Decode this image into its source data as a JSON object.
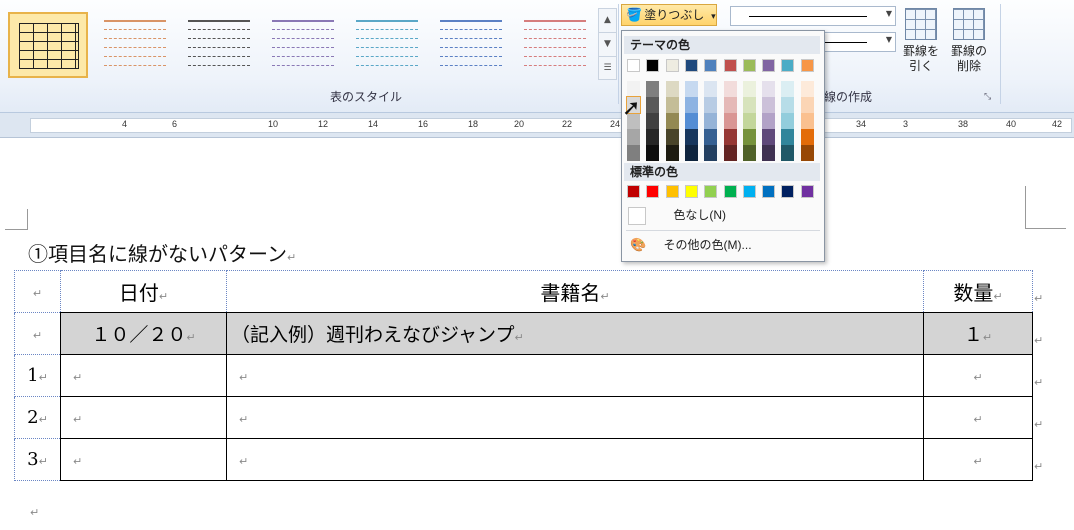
{
  "ribbon": {
    "table_styles_label": "表のスタイル",
    "fill_button_label": "塗りつぶし",
    "fill_button_arrow": "▾",
    "borders_group_label": "罫線の作成",
    "draw_border_label": [
      "罫線を",
      "引く"
    ],
    "erase_border_label": [
      "罫線の",
      "削除"
    ],
    "gallery_scroll": [
      "▲",
      "▼",
      "☰"
    ],
    "style_colors": [
      "#d99467",
      "#555555",
      "#8a78b5",
      "#5aa7c7",
      "#5b80c4",
      "#d67d7d"
    ]
  },
  "ruler": {
    "numbers": [
      "4",
      "6",
      "10",
      "12",
      "14",
      "16",
      "18",
      "20",
      "22",
      "24",
      "34",
      "3",
      "38",
      "40",
      "42"
    ]
  },
  "color_popup": {
    "theme_header": "テーマの色",
    "standard_header": "標準の色",
    "no_color_label": "色なし(N)",
    "more_colors_label": "その他の色(M)...",
    "theme_colors": [
      "#ffffff",
      "#000000",
      "#eeece1",
      "#1f497d",
      "#4f81bd",
      "#c0504d",
      "#9bbb59",
      "#8064a2",
      "#4bacc6",
      "#f79646"
    ],
    "theme_shades": [
      [
        "#f2f2f2",
        "#d9d9d9",
        "#bfbfbf",
        "#a6a6a6",
        "#7f7f7f"
      ],
      [
        "#7f7f7f",
        "#595959",
        "#404040",
        "#262626",
        "#0d0d0d"
      ],
      [
        "#ddd9c3",
        "#c4bd97",
        "#938953",
        "#494429",
        "#1d1b10"
      ],
      [
        "#c6d9f0",
        "#8db3e2",
        "#548dd4",
        "#17365d",
        "#0f243e"
      ],
      [
        "#dbe5f1",
        "#b8cce4",
        "#95b3d7",
        "#366092",
        "#244061"
      ],
      [
        "#f2dcdb",
        "#e5b9b7",
        "#d99694",
        "#953734",
        "#632423"
      ],
      [
        "#ebf1dd",
        "#d7e3bc",
        "#c3d69b",
        "#76923c",
        "#4f6128"
      ],
      [
        "#e5e0ec",
        "#ccc1d9",
        "#b2a2c7",
        "#5f497a",
        "#3f3151"
      ],
      [
        "#dbeef3",
        "#b7dde8",
        "#92cddc",
        "#31859b",
        "#205867"
      ],
      [
        "#fdeada",
        "#fbd5b5",
        "#fac08f",
        "#e36c09",
        "#974806"
      ]
    ],
    "standard_colors": [
      "#c00000",
      "#ff0000",
      "#ffc000",
      "#ffff00",
      "#92d050",
      "#00b050",
      "#00b0f0",
      "#0070c0",
      "#002060",
      "#7030a0"
    ]
  },
  "document": {
    "heading": "①項目名に線がないパターン",
    "para_mark": "↵",
    "headers": [
      "日付",
      "書籍名",
      "数量"
    ],
    "example_row": {
      "date": "１０／２０",
      "title": "（記入例）週刊わえなびジャンプ",
      "qty": "１"
    },
    "row_numbers": [
      "1",
      "2",
      "3"
    ]
  }
}
